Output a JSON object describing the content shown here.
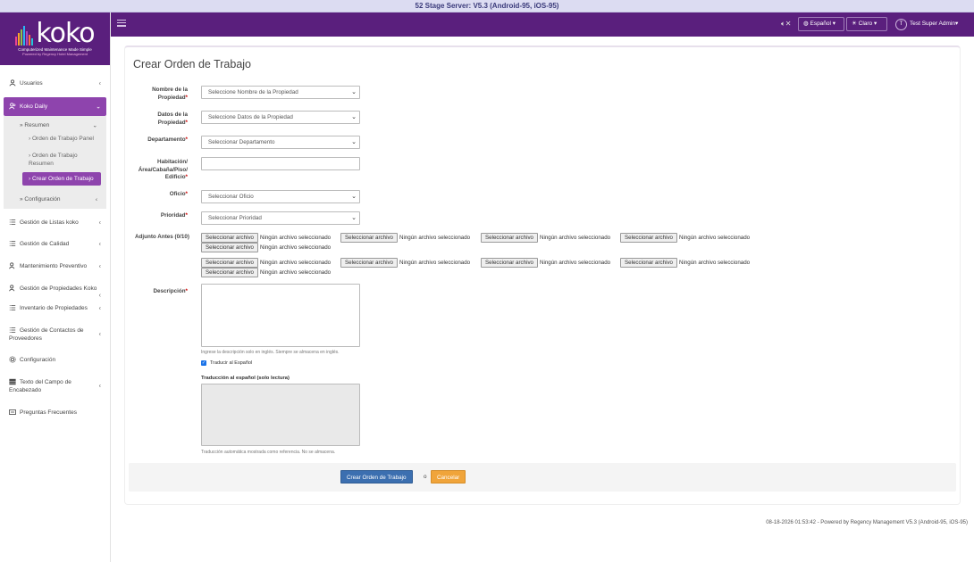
{
  "banner": "52 Stage Server: V5.3 (Android-95, iOS-95)",
  "logo": {
    "word": "koko",
    "tagline": "Computerized Maintenance Made Simple",
    "powered": "Powered by Regency Hotel Management",
    "bar_colors": [
      "#e84393",
      "#f9a825",
      "#8bc34a",
      "#29b6f6",
      "#ab47bc",
      "#ff7043",
      "#26c6da"
    ]
  },
  "topbar": {
    "language": "Español",
    "theme": "Claro",
    "user_initial": "T",
    "user_name": "Test Super Admin"
  },
  "sidebar": {
    "items": [
      {
        "label": "Usuarios",
        "icon": "user-icon"
      },
      {
        "label": "Koko Daily",
        "icon": "users-icon",
        "active": true
      },
      {
        "label": "Gestión de Listas koko",
        "icon": "list-icon"
      },
      {
        "label": "Gestión de Calidad",
        "icon": "list-icon"
      },
      {
        "label": "Mantenimiento Preventivo",
        "icon": "users-icon"
      },
      {
        "label": "Gestión de Propiedades Koko",
        "icon": "users-icon"
      },
      {
        "label": "Inventario de Propiedades",
        "icon": "list-icon"
      },
      {
        "label": "Gestión de Contactos de Proveedores",
        "icon": "list-icon"
      },
      {
        "label": "Configuración",
        "icon": "gear-icon"
      },
      {
        "label": "Texto del Campo de Encabezado",
        "icon": "table-icon"
      },
      {
        "label": "Preguntas Frecuentes",
        "icon": "faq-icon"
      }
    ],
    "resumen": "Resumen",
    "resumen_items": [
      "Orden de Trabajo Panel",
      "Orden de Trabajo Resumen",
      "Crear Orden de Trabajo"
    ],
    "configuracion": "Configuración"
  },
  "form": {
    "title": "Crear Orden de Trabajo",
    "property_name_label": "Nombre de la Propiedad",
    "property_name_placeholder": "Seleccione Nombre de la Propiedad",
    "property_data_label": "Datos de la Propiedad",
    "property_data_placeholder": "Seleccione Datos de la Propiedad",
    "department_label": "Departamento",
    "department_placeholder": "Seleccionar Departamento",
    "room_label": "Habitación/ Área/Cabaña/Piso/ Edificio",
    "trade_label": "Oficio",
    "trade_placeholder": "Seleccionar Oficio",
    "priority_label": "Prioridad",
    "priority_placeholder": "Seleccionar Prioridad",
    "attachments_label": "Adjunto Antes (0/10)",
    "file_button": "Seleccionar archivo",
    "file_none": "Ningún archivo seleccionado",
    "description_label": "Descripción",
    "description_hint": "Ingrese la descripción solo en inglés. Siempre se almacena en inglés.",
    "translate_label": "Traducir al Español",
    "translation_title": "Traducción al español (solo lectura)",
    "translation_hint": "Traducción automática mostrada como referencia. No se almacena.",
    "required_mark": "*",
    "create_button": "Crear Orden de Trabajo",
    "or_text": "o",
    "cancel_button": "Cancelar"
  },
  "footer": "08-18-2026 01:53:42 - Powered by Regency Management V5.3 (Android-95, iOS-95)"
}
